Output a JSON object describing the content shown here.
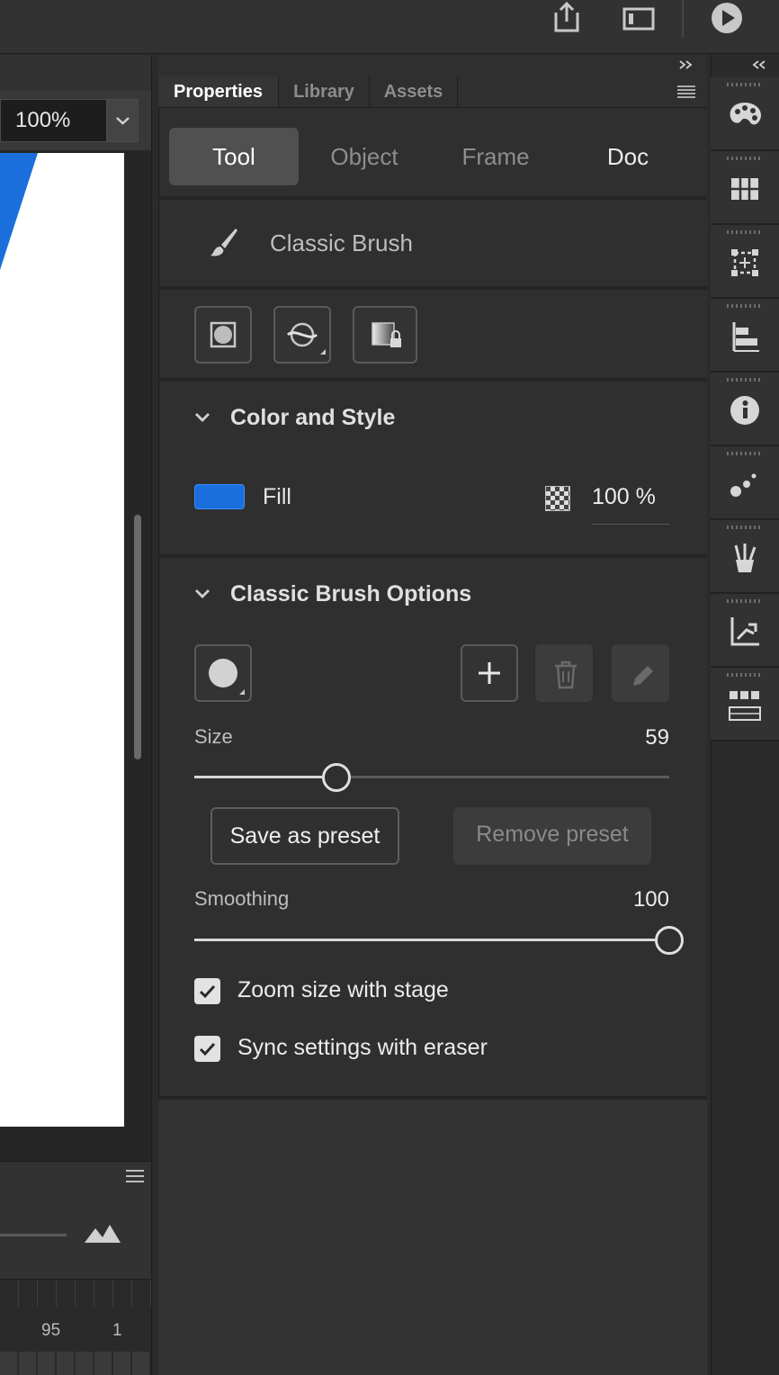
{
  "zoom": {
    "value": "100%"
  },
  "panel": {
    "tabs": [
      {
        "label": "Properties",
        "active": true
      },
      {
        "label": "Library",
        "active": false
      },
      {
        "label": "Assets",
        "active": false
      }
    ],
    "segments": [
      {
        "label": "Tool",
        "active": true
      },
      {
        "label": "Object",
        "active": false
      },
      {
        "label": "Frame",
        "active": false
      },
      {
        "label": "Doc",
        "active": false
      }
    ],
    "tool_name": "Classic Brush",
    "color_style": {
      "title": "Color and Style",
      "fill_label": "Fill",
      "fill_color": "#1a6fdc",
      "opacity": "100 %"
    },
    "brush_options": {
      "title": "Classic Brush Options",
      "size_label": "Size",
      "size_value": "59",
      "size_fraction": 0.3,
      "save_preset": "Save as preset",
      "remove_preset": "Remove preset",
      "smoothing_label": "Smoothing",
      "smoothing_value": "100",
      "smoothing_fraction": 1.0,
      "zoom_with_stage": "Zoom size with stage",
      "zoom_with_stage_checked": true,
      "sync_eraser": "Sync settings with eraser",
      "sync_eraser_checked": true
    }
  },
  "timeline": {
    "labels": [
      "95",
      "1"
    ]
  },
  "accent": "#1a6fdc"
}
